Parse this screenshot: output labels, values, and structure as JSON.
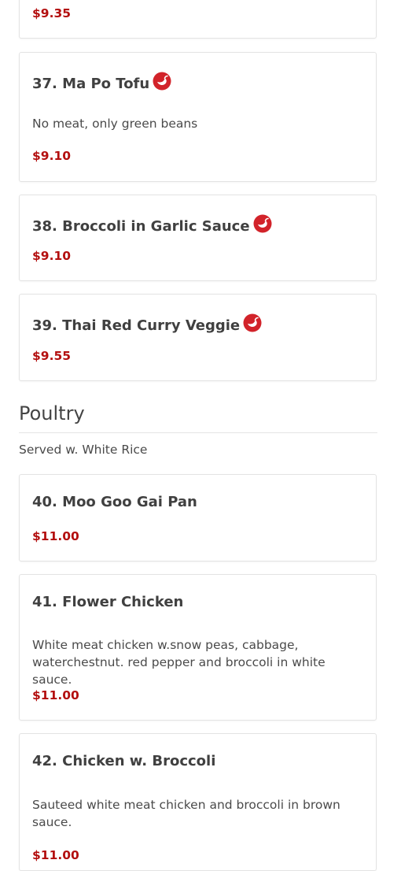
{
  "top_partial_item": {
    "price": "$9.35"
  },
  "items_vegetable": [
    {
      "name": "37. Ma Po Tofu",
      "spicy": true,
      "description": "No meat, only green beans",
      "price": "$9.10"
    },
    {
      "name": "38. Broccoli in Garlic Sauce",
      "spicy": true,
      "description": "",
      "price": "$9.10"
    },
    {
      "name": "39. Thai Red Curry Veggie",
      "spicy": true,
      "description": "",
      "price": "$9.55"
    }
  ],
  "section_poultry": {
    "title": "Poultry",
    "note": "Served w. White Rice",
    "items": [
      {
        "name": "40. Moo Goo Gai Pan",
        "description": "",
        "price": "$11.00"
      },
      {
        "name": "41. Flower Chicken",
        "description": "White meat chicken w.snow peas, cabbage, waterchestnut. red pepper and broccoli in white sauce.",
        "price": "$11.00"
      },
      {
        "name": "42. Chicken w. Broccoli",
        "description": "Sauteed white meat chicken and broccoli in brown sauce.",
        "price": "$11.00"
      }
    ]
  },
  "colors": {
    "price": "#b30f0f",
    "spicy_icon": "#d2232a",
    "card_border": "#e3e3e3"
  },
  "icons": {
    "spicy": "chili-pepper-icon"
  }
}
